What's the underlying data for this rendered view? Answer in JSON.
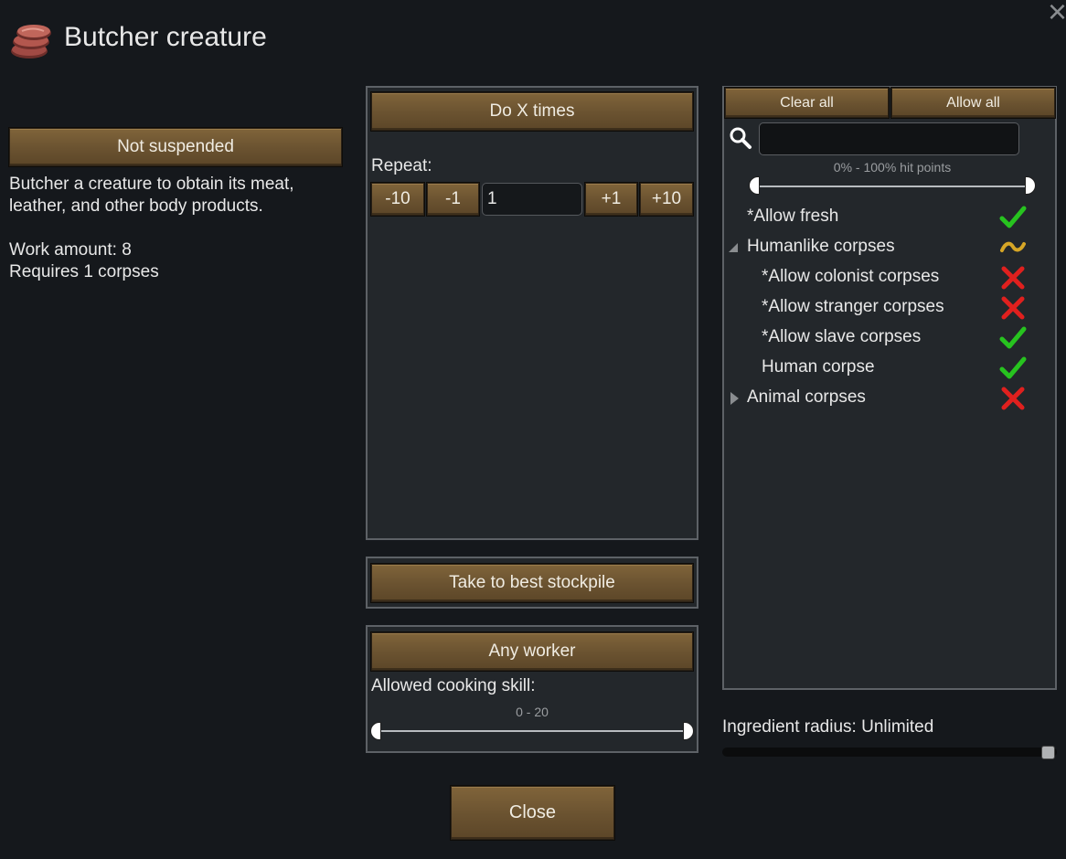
{
  "dialog": {
    "title": "Butcher creature",
    "close_x": "×",
    "close_label": "Close"
  },
  "left": {
    "suspend_label": "Not suspended",
    "description_line1": "Butcher a creature to obtain its meat,",
    "description_line2": "leather, and other body products.",
    "work_amount": "Work amount: 8",
    "requires": "Requires 1 corpses"
  },
  "repeat": {
    "mode_label": "Do X times",
    "repeat_label": "Repeat:",
    "minus10": "-10",
    "minus1": "-1",
    "count_value": "1",
    "plus1": "+1",
    "plus10": "+10"
  },
  "store": {
    "label": "Take to best stockpile"
  },
  "worker": {
    "label": "Any worker",
    "skill_label": "Allowed cooking skill:",
    "skill_range": "0 - 20",
    "skill_min": 0,
    "skill_max": 20
  },
  "filter": {
    "clear_all": "Clear all",
    "allow_all": "Allow all",
    "search_value": "",
    "hp_range": "0% - 100% hit points",
    "items": [
      {
        "label": "*Allow fresh",
        "state": "allowed"
      },
      {
        "label": "Humanlike corpses",
        "state": "partial",
        "expander": "expanded"
      },
      {
        "label": "*Allow colonist corpses",
        "state": "disallowed"
      },
      {
        "label": "*Allow stranger corpses",
        "state": "disallowed"
      },
      {
        "label": "*Allow slave corpses",
        "state": "allowed"
      },
      {
        "label": "Human corpse",
        "state": "allowed"
      },
      {
        "label": "Animal corpses",
        "state": "disallowed",
        "expander": "collapsed"
      }
    ]
  },
  "radius": {
    "label": "Ingredient radius: Unlimited",
    "fraction": 1.0
  },
  "colors": {
    "allowed": "#27c31f",
    "disallowed": "#e0201e",
    "partial": "#d6a626",
    "button": "#6a5230"
  }
}
